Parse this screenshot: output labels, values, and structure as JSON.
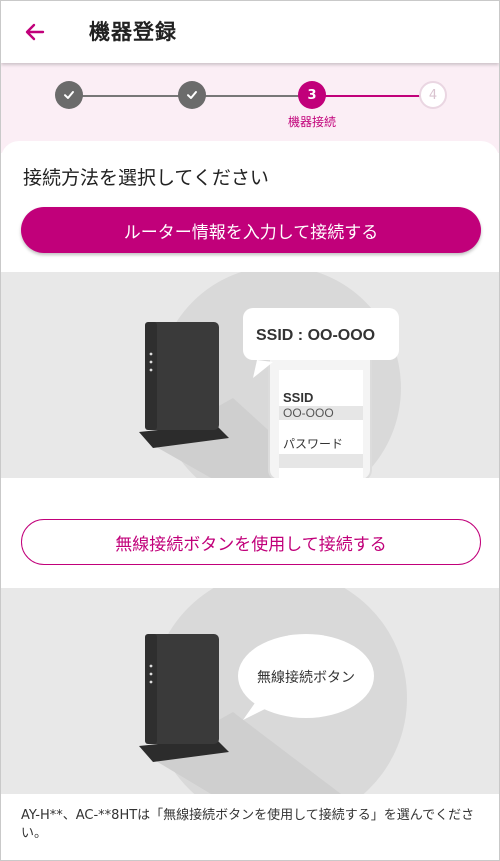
{
  "header": {
    "back_icon": "arrow-left-icon",
    "title": "機器登録"
  },
  "stepper": {
    "steps": [
      {
        "state": "done",
        "icon": "check-icon"
      },
      {
        "state": "done",
        "icon": "check-icon"
      },
      {
        "state": "current",
        "number": "3",
        "label": "機器接続"
      },
      {
        "state": "future",
        "number": "4"
      }
    ]
  },
  "main": {
    "instruction": "接続方法を選択してください",
    "router_info_button": "ルーター情報を入力して接続する",
    "ssid_bubble": "SSID : OO-OOO",
    "phone_ssid_label": "SSID",
    "phone_ssid_value": "OO-OOO",
    "phone_password_label": "パスワード",
    "wps_button": "無線接続ボタンを使用して接続する",
    "wps_bubble": "無線接続ボタン",
    "footnote": "AY-H**、AC-**8HTは「無線接続ボタンを使用して接続する」を選んでください。"
  },
  "colors": {
    "accent": "#c1007a",
    "stepper_bg": "#fbeef5",
    "illustration_bg": "#e8e8e8",
    "router": "#3a3a3a"
  }
}
